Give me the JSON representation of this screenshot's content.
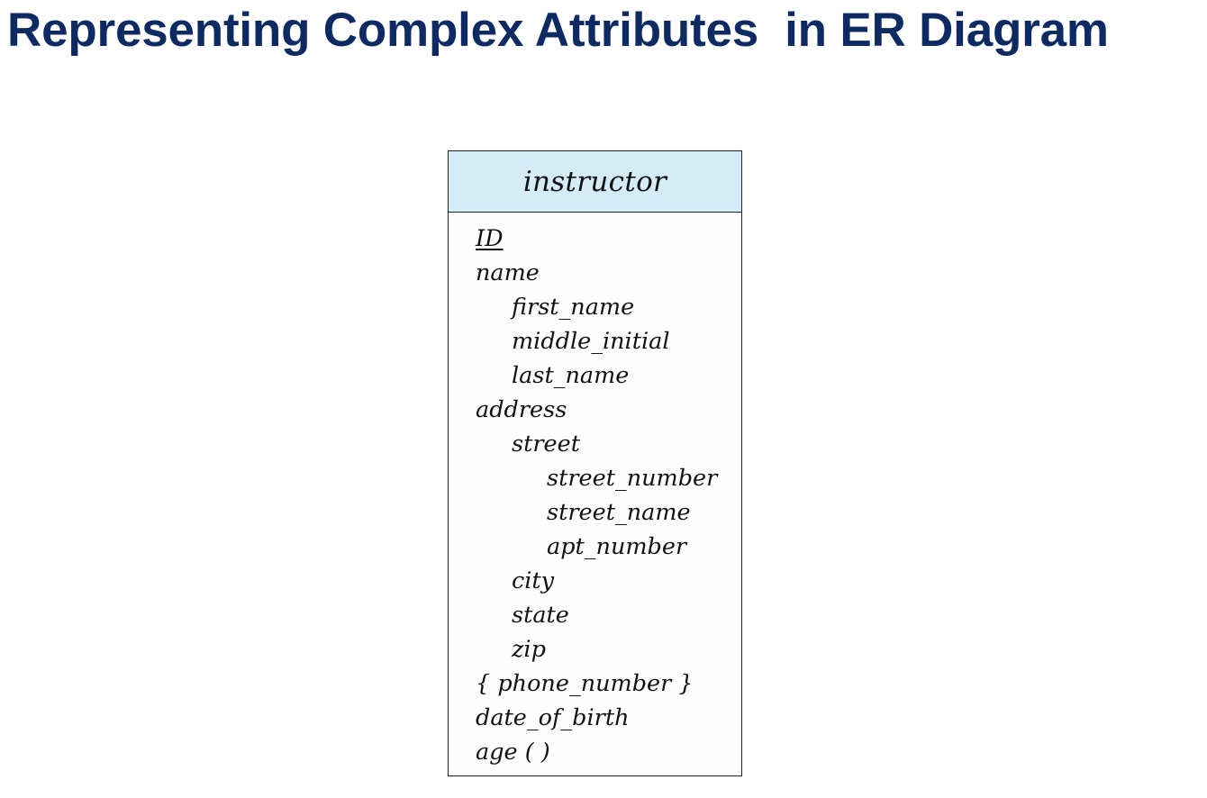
{
  "slide": {
    "title": "Representing Complex Attributes  in ER Diagram"
  },
  "entity": {
    "name": "instructor",
    "attributes": [
      {
        "text": "ID",
        "level": 0,
        "key": true
      },
      {
        "text": "name",
        "level": 0
      },
      {
        "text": "first_name",
        "level": 1
      },
      {
        "text": "middle_initial",
        "level": 1
      },
      {
        "text": "last_name",
        "level": 1
      },
      {
        "text": "address",
        "level": 0
      },
      {
        "text": "street",
        "level": 1
      },
      {
        "text": "street_number",
        "level": 2
      },
      {
        "text": "street_name",
        "level": 2
      },
      {
        "text": "apt_number",
        "level": 2
      },
      {
        "text": "city",
        "level": 1
      },
      {
        "text": "state",
        "level": 1
      },
      {
        "text": "zip",
        "level": 1
      },
      {
        "text": "{ phone_number }",
        "level": 0
      },
      {
        "text": "date_of_birth",
        "level": 0
      },
      {
        "text": "age ( )",
        "level": 0
      }
    ]
  },
  "colors": {
    "title": "#0d2a63",
    "header_fill": "#d3ecf7",
    "border": "#222222"
  }
}
